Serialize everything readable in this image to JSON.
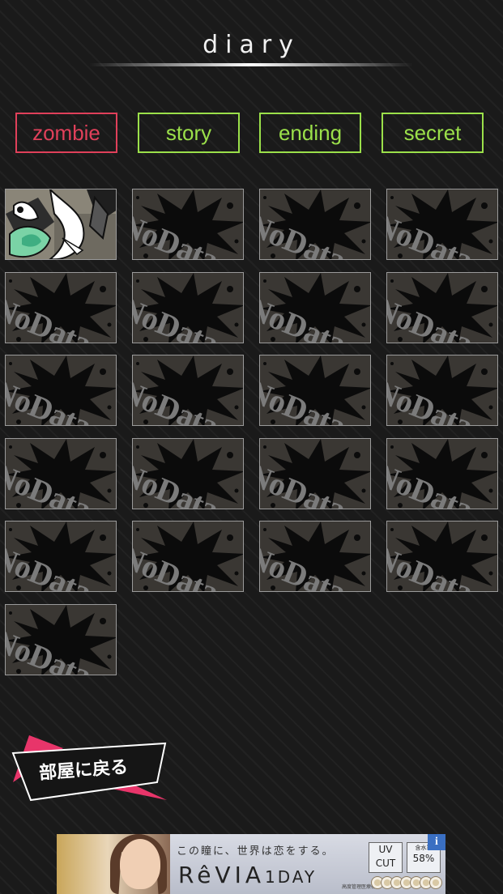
{
  "header": {
    "title": "diary"
  },
  "tabs": [
    {
      "label": "zombie",
      "active": true
    },
    {
      "label": "story",
      "active": false
    },
    {
      "label": "ending",
      "active": false
    },
    {
      "label": "secret",
      "active": false
    }
  ],
  "grid": {
    "placeholder_text": "NoData",
    "total_slots": 21,
    "unlocked_slots": 1
  },
  "back_button": {
    "label": "部屋に戻る"
  },
  "ad": {
    "tagline": "この瞳に、世界は恋をする。",
    "brand": "RêVIA",
    "brand_sub": "1DAY",
    "uv_line1": "UV",
    "uv_line2": "CUT",
    "water_label": "含水率",
    "water_value": "58%",
    "small_print": "高度管理医療機器",
    "info_label": "i"
  },
  "colors": {
    "active_tab": "#e0405a",
    "inactive_tab": "#9be04a",
    "background": "#1a1a1a",
    "back_button_accent": "#e8356a"
  }
}
